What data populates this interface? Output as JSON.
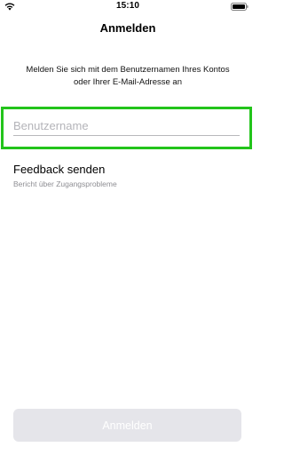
{
  "status_bar": {
    "time": "15:10",
    "wifi_icon": "wifi-icon",
    "battery_icon": "battery-icon"
  },
  "nav": {
    "title": "Anmelden"
  },
  "instructions": {
    "line1": "Melden Sie sich mit dem Benutzernamen Ihres Kontos",
    "line2": "oder Ihrer E-Mail-Adresse an"
  },
  "username": {
    "placeholder": "Benutzername",
    "value": "",
    "highlight_color": "#23c41b"
  },
  "feedback": {
    "title": "Feedback senden",
    "subtitle": "Bericht über Zugangsprobleme"
  },
  "login_button": {
    "label": "Anmelden",
    "background": "#e5e5ea",
    "enabled": false
  }
}
